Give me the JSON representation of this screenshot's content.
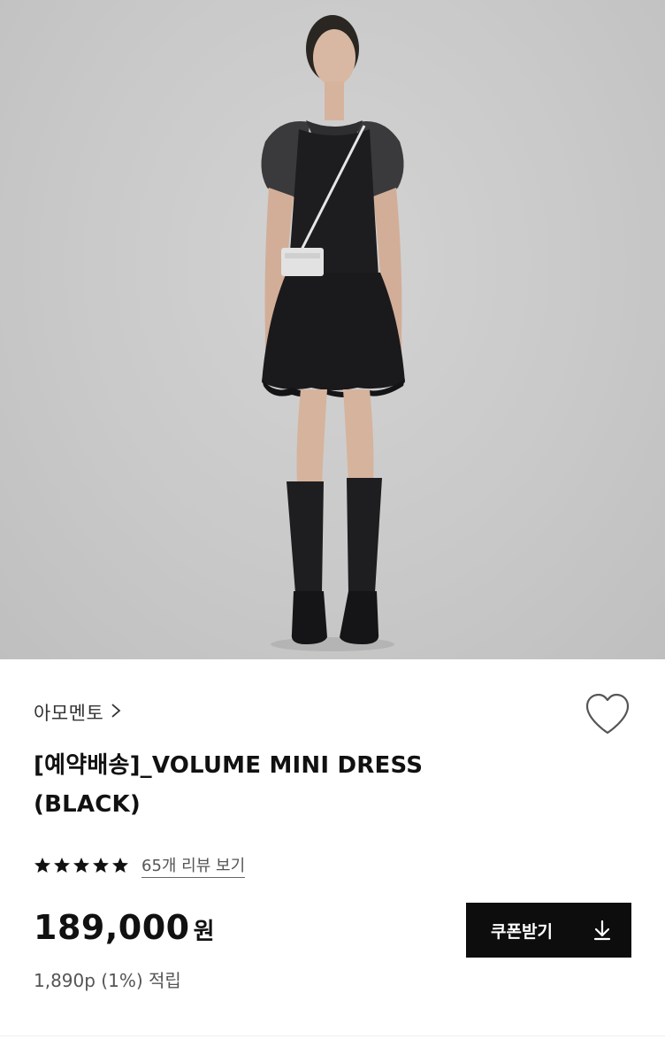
{
  "product": {
    "brand": "아모멘토",
    "title_line1": "[예약배송]_VOLUME MINI DRESS",
    "title_line2": "(BLACK)",
    "rating_stars": 5,
    "review_link": "65개 리뷰 보기",
    "price": "189,000",
    "price_unit": "원",
    "points": "1,890p (1%) 적립"
  },
  "actions": {
    "coupon_label": "쿠폰받기"
  },
  "icons": {
    "brand_chevron": "chevron-right-icon",
    "wish": "heart-outline-icon",
    "star": "star-filled-icon",
    "download": "download-icon"
  },
  "colors": {
    "primary_text": "#111111",
    "secondary_text": "#555555",
    "button_bg": "#0d0d0d",
    "image_bg": "#c9c9c9"
  }
}
